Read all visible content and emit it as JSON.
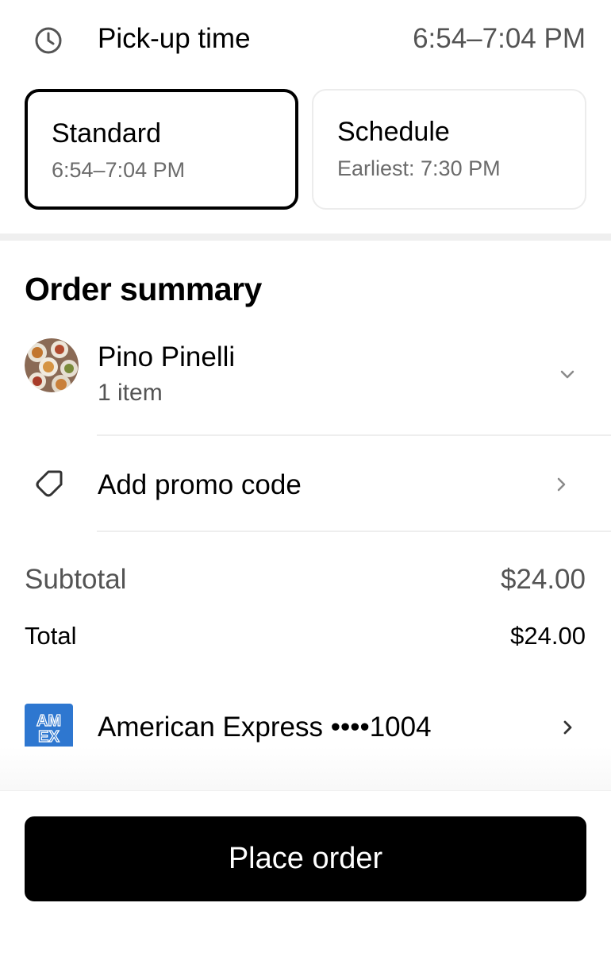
{
  "pickup": {
    "icon": "clock-icon",
    "label": "Pick-up time",
    "value": "6:54–7:04 PM"
  },
  "options": [
    {
      "title": "Standard",
      "subtitle": "6:54–7:04 PM",
      "selected": true
    },
    {
      "title": "Schedule",
      "subtitle": "Earliest: 7:30 PM",
      "selected": false
    }
  ],
  "order_summary": {
    "title": "Order summary",
    "store": {
      "name": "Pino Pinelli",
      "count": "1 item",
      "expand_icon": "chevron-down-icon"
    },
    "promo": {
      "icon": "tag-icon",
      "label": "Add promo code"
    },
    "subtotal": {
      "label": "Subtotal",
      "value": "$24.00"
    },
    "total": {
      "label": "Total",
      "value": "$24.00"
    }
  },
  "payment": {
    "brand_logo_text": "AMEX",
    "label": "American Express ••••1004",
    "brand_color": "#2e77d0"
  },
  "place_order": {
    "label": "Place order"
  },
  "colors": {
    "primary": "#000000",
    "secondary_text": "#545454",
    "divider": "#eeeeee"
  }
}
